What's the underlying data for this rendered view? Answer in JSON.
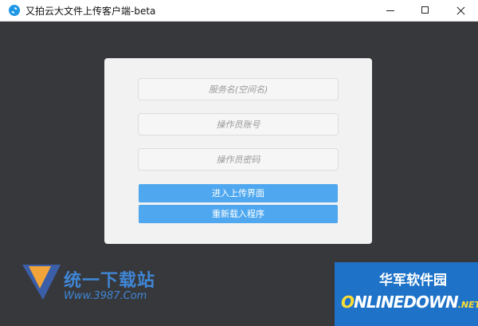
{
  "window": {
    "title": "又拍云大文件上传客户端-beta",
    "icon": "upyun-logo-icon",
    "controls": [
      "minimize-icon",
      "maximize-icon",
      "close-icon"
    ]
  },
  "form": {
    "service_placeholder": "服务名(空间名)",
    "operator_placeholder": "操作员账号",
    "password_placeholder": "操作员密码",
    "enter_button": "进入上传界面",
    "reload_button": "重新载入程序"
  },
  "watermark_left": {
    "title": "统一下载站",
    "url": "Www.3987.Com"
  },
  "watermark_right": {
    "title": "华军软件园",
    "sub_o": "O",
    "sub": "NLINEDOWN",
    "net": ".NET"
  },
  "colors": {
    "background": "#37383b",
    "card": "#f2f2f2",
    "button": "#4fa8ef",
    "watermark_blue": "#1e73c8"
  }
}
